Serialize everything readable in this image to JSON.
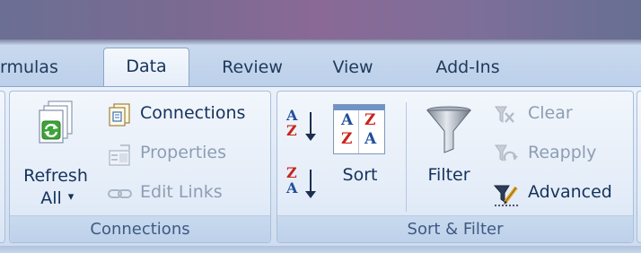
{
  "tabs": [
    {
      "label": "rmulas",
      "active": false
    },
    {
      "label": "Data",
      "active": true
    },
    {
      "label": "Review",
      "active": false
    },
    {
      "label": "View",
      "active": false
    },
    {
      "label": "Add-Ins",
      "active": false
    }
  ],
  "connections_group": {
    "label": "Connections",
    "refresh_all": {
      "line1": "Refresh",
      "line2": "All",
      "arrow": "▾",
      "icon": "refresh-icon"
    },
    "connections": {
      "label": "Connections",
      "icon": "connections-icon",
      "enabled": true
    },
    "properties": {
      "label": "Properties",
      "icon": "properties-icon",
      "enabled": false
    },
    "edit_links": {
      "label": "Edit Links",
      "icon": "chain-link-icon",
      "enabled": false
    }
  },
  "sort_filter_group": {
    "label": "Sort & Filter",
    "sort_az": {
      "top": "A",
      "bottom": "Z",
      "icon": "sort-a-to-z-icon"
    },
    "sort_za": {
      "top": "Z",
      "bottom": "A",
      "icon": "sort-z-to-a-icon"
    },
    "sort": {
      "label": "Sort",
      "icon_letters": [
        "A",
        "Z",
        "Z",
        "A"
      ],
      "icon": "sort-dialog-icon"
    },
    "filter": {
      "label": "Filter",
      "icon": "funnel-icon"
    },
    "clear": {
      "label": "Clear",
      "icon": "clear-filter-icon",
      "enabled": false
    },
    "reapply": {
      "label": "Reapply",
      "icon": "reapply-icon",
      "enabled": false
    },
    "advanced": {
      "label": "Advanced",
      "icon": "advanced-filter-icon",
      "enabled": true
    }
  },
  "colors": {
    "text": "#15325b",
    "disabled_text": "#8d9db3",
    "sort_red": "#c8241c",
    "sort_blue": "#1f4f9b"
  }
}
